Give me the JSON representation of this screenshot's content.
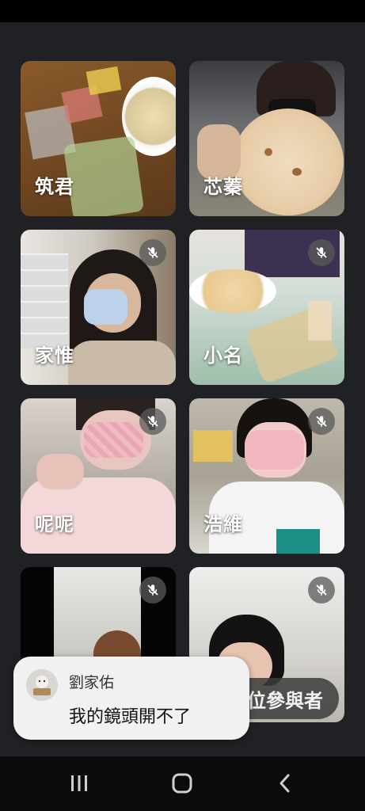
{
  "participants": [
    {
      "name": "筑君",
      "muted": false
    },
    {
      "name": "芯蓁",
      "muted": false
    },
    {
      "name": "家惟",
      "muted": true
    },
    {
      "name": "小名",
      "muted": true
    },
    {
      "name": "呢呢",
      "muted": true
    },
    {
      "name": "浩維",
      "muted": true
    },
    {
      "name": "",
      "muted": true
    },
    {
      "name": "",
      "muted": true
    }
  ],
  "more_participants_label": "還有另外 5 位參與者",
  "chat_toast": {
    "sender": "劉家佑",
    "message": "我的鏡頭開不了"
  },
  "navbar": {
    "recent_icon": "recent-apps-icon",
    "home_icon": "home-icon",
    "back_icon": "back-icon"
  },
  "colors": {
    "background": "#202124",
    "toast_bg": "#f1f1f1",
    "mute_badge": "#5a5a5a"
  }
}
